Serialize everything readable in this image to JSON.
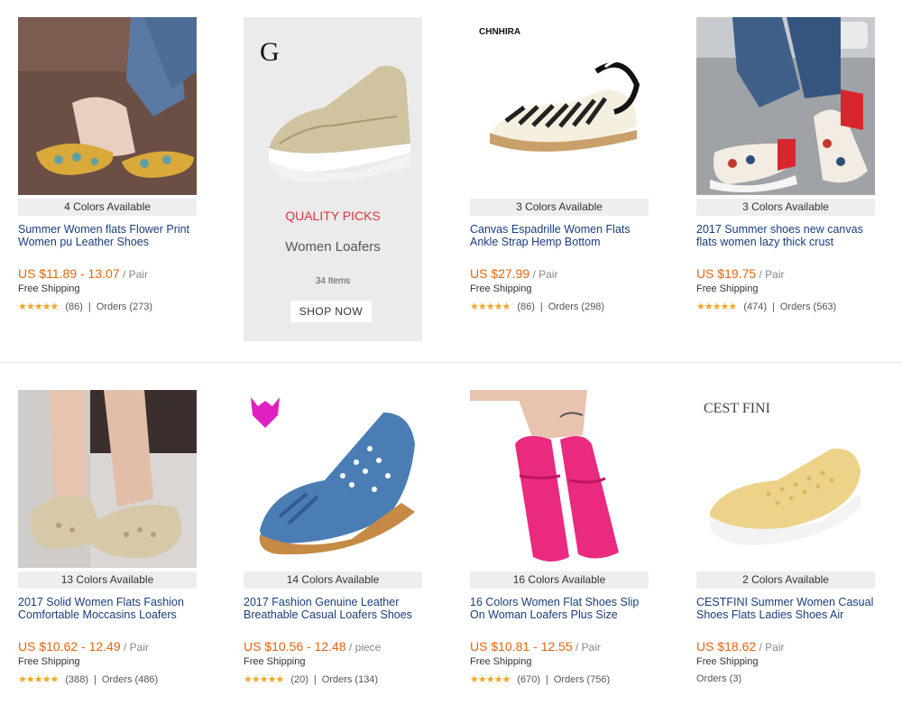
{
  "promo": {
    "brand_logo": "G",
    "label": "QUALITY PICKS",
    "title": "Women Loafers",
    "count": "34 Items",
    "button": "SHOP NOW"
  },
  "products": [
    {
      "colors": "4 Colors Available",
      "title": "Summer Women flats Flower Print Women pu Leather Shoes",
      "price": "US $11.89 - 13.07",
      "unit": " / Pair",
      "shipping": "Free Shipping",
      "reviews": "(86)",
      "orders": "Orders (273)",
      "stars": 5
    },
    {
      "brand": "CHNHIRA",
      "colors": "3 Colors Available",
      "title": "Canvas Espadrille Women Flats Ankle Strap Hemp Bottom",
      "price": "US $27.99",
      "unit": " / Pair",
      "shipping": "Free Shipping",
      "reviews": "(86)",
      "orders": "Orders (298)",
      "stars": 5
    },
    {
      "colors": "3 Colors Available",
      "title": "2017 Summer shoes new canvas flats women lazy thick crust",
      "price": "US $19.75",
      "unit": " / Pair",
      "shipping": "Free Shipping",
      "reviews": "(474)",
      "orders": "Orders (563)",
      "stars": 5
    },
    {
      "colors": "13 Colors Available",
      "title": "2017 Solid Women Flats Fashion Comfortable Moccasins Loafers",
      "price": "US $10.62 - 12.49",
      "unit": " / Pair",
      "shipping": "Free Shipping",
      "reviews": "(388)",
      "orders": "Orders (486)",
      "stars": 5
    },
    {
      "colors": "14 Colors Available",
      "title": "2017 Fashion Genuine Leather Breathable Casual Loafers Shoes",
      "price": "US $10.56 - 12.48",
      "unit": " / piece",
      "shipping": "Free Shipping",
      "reviews": "(20)",
      "orders": "Orders (134)",
      "stars": 5
    },
    {
      "colors": "16 Colors Available",
      "title": "16 Colors Women Flat Shoes Slip On Woman Loafers Plus Size",
      "price": "US $10.81 - 12.55",
      "unit": " / Pair",
      "shipping": "Free Shipping",
      "reviews": "(670)",
      "orders": "Orders (756)",
      "stars": 5
    },
    {
      "brand": "CEST FINI",
      "colors": "2 Colors Available",
      "title": "CESTFINI Summer Women Casual Shoes Flats Ladies Shoes Air",
      "price": "US $18.62",
      "unit": " / Pair",
      "shipping": "Free Shipping",
      "orders": "Orders (3)"
    }
  ],
  "separator": "|",
  "star_glyphs": "★★★★★",
  "colors": {
    "link": "#1a3d7c",
    "price": "#e8650c",
    "star": "#f5a623",
    "promo_label": "#d9363e"
  }
}
